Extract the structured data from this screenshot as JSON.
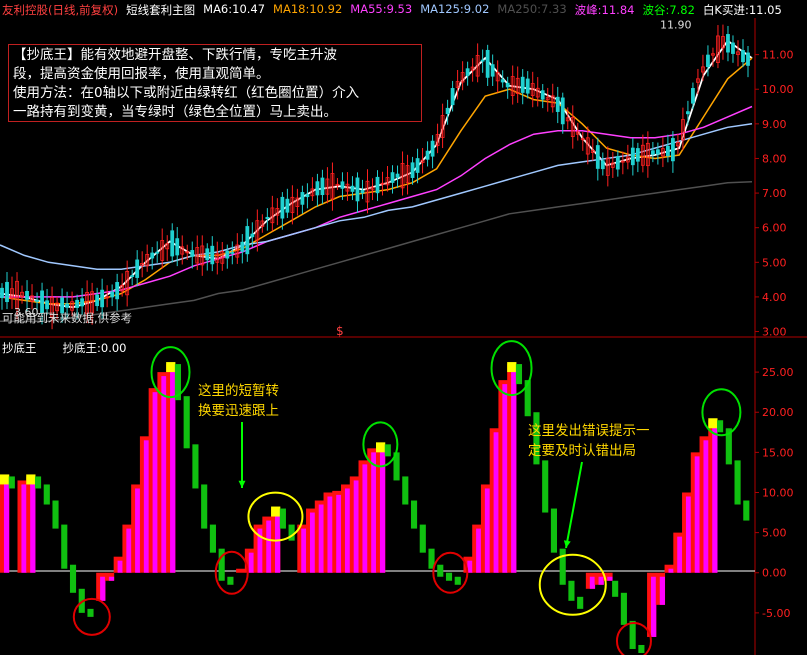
{
  "header": {
    "stock": "友利控股(日线,前复权)",
    "formula": "短线套利主图",
    "ma6": "MA6:10.47",
    "ma18": "MA18:10.92",
    "ma55": "MA55:9.53",
    "ma125": "MA125:9.02",
    "ma250": "MA250:7.33",
    "peak_label": "波峰:11.84",
    "valley_label": "波谷:7.82",
    "white_k": "白K买进:11.05"
  },
  "colors": {
    "stock": "#ff4040",
    "formula": "#ffffff",
    "ma6": "#ffffff",
    "ma18": "#ffa500",
    "ma55": "#ff40ff",
    "ma125": "#a0c8ff",
    "ma250": "#505050",
    "peak": "#ff40ff",
    "valley": "#00ff00",
    "white_k": "#ffffff",
    "up": "#ff2020",
    "down": "#20d0d0",
    "hist_red": "#ff1010",
    "hist_magenta": "#ff00ff",
    "hist_yellow": "#ffff00",
    "hist_green": "#10c010",
    "circle_green": "#00e000",
    "circle_red": "#e00000",
    "circle_yellow": "#ffff00",
    "arrow": "#00ff00",
    "axis": "#b00000"
  },
  "info_box": {
    "line1": "【抄底王】能有效地避开盘整、下跌行情，专吃主升波",
    "line2": "段，提高资金使用回报率，使用直观简单。",
    "line3": "使用方法：在0轴以下或附近由绿转红（红色圈位置）介入",
    "line4": "一路持有到变黄，当专绿时（绿色全位置）马上卖出。"
  },
  "warning_text": "可能用到未来数据,供参考",
  "dollar_mark": "$",
  "indicator_header": {
    "name": "抄底王",
    "value": "抄底王:0.00"
  },
  "annotations": {
    "left_line1": "这里的短暂转",
    "left_line2": "换要迅速跟上",
    "right_line1": "这里发出错误提示一",
    "right_line2": "定要及时认错出局"
  },
  "chart_data": [
    {
      "type": "line",
      "subtype": "candlestick_with_moving_averages",
      "title": "友利控股(日线,前复权)",
      "ylim": [
        2.9,
        12.0
      ],
      "yticks": [
        "3.00",
        "4.00",
        "5.00",
        "6.00",
        "7.00",
        "8.00",
        "9.00",
        "10.00",
        "11.00"
      ],
      "price_labels": {
        "high": "11.90",
        "low": "3.60"
      },
      "series": [
        {
          "name": "MA6",
          "y": [
            4.1,
            4.0,
            3.8,
            3.7,
            3.9,
            4.3,
            5.0,
            5.6,
            5.2,
            5.1,
            5.5,
            6.2,
            6.7,
            7.1,
            7.2,
            7.1,
            7.3,
            7.6,
            8.4,
            10.2,
            10.9,
            10.1,
            10.0,
            9.7,
            8.6,
            7.8,
            8.0,
            8.1,
            8.3,
            10.4,
            11.4,
            10.9
          ]
        },
        {
          "name": "MA18",
          "y": [
            4.0,
            3.9,
            3.8,
            3.8,
            3.9,
            4.1,
            4.5,
            5.0,
            5.2,
            5.2,
            5.4,
            5.8,
            6.2,
            6.6,
            6.9,
            7.0,
            7.1,
            7.3,
            7.7,
            8.8,
            9.8,
            10.0,
            9.7,
            9.6,
            9.0,
            8.3,
            8.1,
            8.0,
            8.1,
            9.2,
            10.3,
            10.9
          ]
        },
        {
          "name": "MA55",
          "y": [
            4.0,
            4.0,
            4.0,
            4.0,
            4.1,
            4.2,
            4.4,
            4.6,
            4.9,
            5.1,
            5.3,
            5.6,
            5.8,
            6.0,
            6.3,
            6.5,
            6.7,
            6.9,
            7.1,
            7.5,
            8.0,
            8.4,
            8.7,
            8.8,
            8.8,
            8.7,
            8.6,
            8.6,
            8.7,
            8.9,
            9.2,
            9.5
          ]
        },
        {
          "name": "MA125",
          "y": [
            5.5,
            5.2,
            5.0,
            4.9,
            4.8,
            4.8,
            4.9,
            5.0,
            5.2,
            5.3,
            5.5,
            5.6,
            5.8,
            6.0,
            6.2,
            6.3,
            6.5,
            6.6,
            6.8,
            7.0,
            7.2,
            7.4,
            7.6,
            7.8,
            7.9,
            8.0,
            8.1,
            8.3,
            8.5,
            8.7,
            8.9,
            9.0
          ]
        },
        {
          "name": "MA250",
          "y": [
            3.3,
            3.3,
            3.3,
            3.4,
            3.5,
            3.6,
            3.7,
            3.8,
            3.9,
            4.1,
            4.2,
            4.4,
            4.6,
            4.8,
            5.0,
            5.2,
            5.4,
            5.6,
            5.8,
            6.0,
            6.2,
            6.4,
            6.5,
            6.6,
            6.7,
            6.8,
            6.9,
            7.0,
            7.1,
            7.2,
            7.3,
            7.33
          ]
        }
      ]
    },
    {
      "type": "bar",
      "title": "抄底王",
      "ylim": [
        -10,
        29
      ],
      "yticks": [
        "-5.00",
        "0.00",
        "5.00",
        "10.00",
        "15.00",
        "20.00",
        "25.00"
      ],
      "series": [
        {
          "name": "抄底王",
          "values": [
            12,
            11,
            11.5,
            12,
            11,
            9,
            6,
            1,
            -2,
            -4.5,
            -5,
            -3.5,
            -1,
            2,
            6,
            11,
            17,
            23,
            25,
            26,
            22,
            16,
            11,
            6,
            3,
            -0.5,
            -1,
            0.5,
            3,
            6,
            7,
            8,
            6,
            4.5,
            6,
            8,
            9,
            10,
            10.2,
            11,
            12,
            14,
            15.5,
            16,
            15,
            12,
            9,
            6,
            3,
            1,
            0,
            -0.5,
            -1,
            2,
            6,
            11,
            18,
            24,
            26,
            24,
            20,
            14,
            8,
            3,
            -1,
            -3,
            -4,
            -2,
            -1.5,
            -1,
            -2.5,
            -6,
            -9,
            -9.5,
            -8,
            -4,
            1,
            5,
            10,
            15,
            17,
            19,
            18,
            14,
            9,
            7
          ]
        }
      ]
    }
  ]
}
